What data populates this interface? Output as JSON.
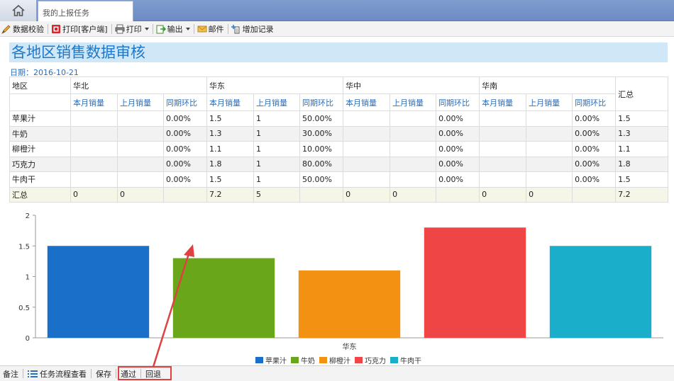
{
  "tab": {
    "title": "我的上报任务"
  },
  "toolbar": {
    "validate": "数据校验",
    "print_client": "打印[客户端]",
    "print": "打印",
    "export": "输出",
    "mail": "邮件",
    "add_record": "增加记录"
  },
  "report": {
    "title": "各地区销售数据审核",
    "date_label": "日期：",
    "date": "2016-10-21",
    "region_header": "地区",
    "total_header": "汇总",
    "regions": [
      "华北",
      "华东",
      "华中",
      "华南"
    ],
    "subheaders": [
      "本月销量",
      "上月销量",
      "同期环比"
    ],
    "rows": [
      {
        "name": "苹果汁",
        "cells": [
          "",
          "",
          "0.00%",
          "1.5",
          "1",
          "50.00%",
          "",
          "",
          "0.00%",
          "",
          "",
          "0.00%",
          "1.5"
        ]
      },
      {
        "name": "牛奶",
        "cells": [
          "",
          "",
          "0.00%",
          "1.3",
          "1",
          "30.00%",
          "",
          "",
          "0.00%",
          "",
          "",
          "0.00%",
          "1.3"
        ]
      },
      {
        "name": "柳橙汁",
        "cells": [
          "",
          "",
          "0.00%",
          "1.1",
          "1",
          "10.00%",
          "",
          "",
          "0.00%",
          "",
          "",
          "0.00%",
          "1.1"
        ]
      },
      {
        "name": "巧克力",
        "cells": [
          "",
          "",
          "0.00%",
          "1.8",
          "1",
          "80.00%",
          "",
          "",
          "0.00%",
          "",
          "",
          "0.00%",
          "1.8"
        ]
      },
      {
        "name": "牛肉干",
        "cells": [
          "",
          "",
          "0.00%",
          "1.5",
          "1",
          "50.00%",
          "",
          "",
          "0.00%",
          "",
          "",
          "0.00%",
          "1.5"
        ]
      }
    ],
    "total_row": {
      "name": "汇总",
      "cells": [
        "0",
        "0",
        "",
        "7.2",
        "5",
        "",
        "0",
        "0",
        "",
        "0",
        "0",
        "",
        "7.2"
      ]
    }
  },
  "chart_data": {
    "type": "bar",
    "categories": [
      "华东"
    ],
    "series": [
      {
        "name": "苹果汁",
        "values": [
          1.5
        ],
        "color": "#1a6fc9"
      },
      {
        "name": "牛奶",
        "values": [
          1.3
        ],
        "color": "#6aa61a"
      },
      {
        "name": "柳橙汁",
        "values": [
          1.1
        ],
        "color": "#f39212"
      },
      {
        "name": "巧克力",
        "values": [
          1.8
        ],
        "color": "#f04545"
      },
      {
        "name": "牛肉干",
        "values": [
          1.5
        ],
        "color": "#1aaecb"
      }
    ],
    "yticks": [
      "0",
      "0.5",
      "1",
      "1.5",
      "2"
    ],
    "ylim": [
      0,
      2
    ],
    "legend": "bottom",
    "grid": false
  },
  "bottombar": {
    "note": "备注",
    "flow": "任务流程查看",
    "save": "保存",
    "approve": "通过",
    "reject": "回退"
  },
  "colors": {
    "highlight": "#e04040",
    "title_bg": "#cfe7f7",
    "title_text": "#1f77c8"
  }
}
